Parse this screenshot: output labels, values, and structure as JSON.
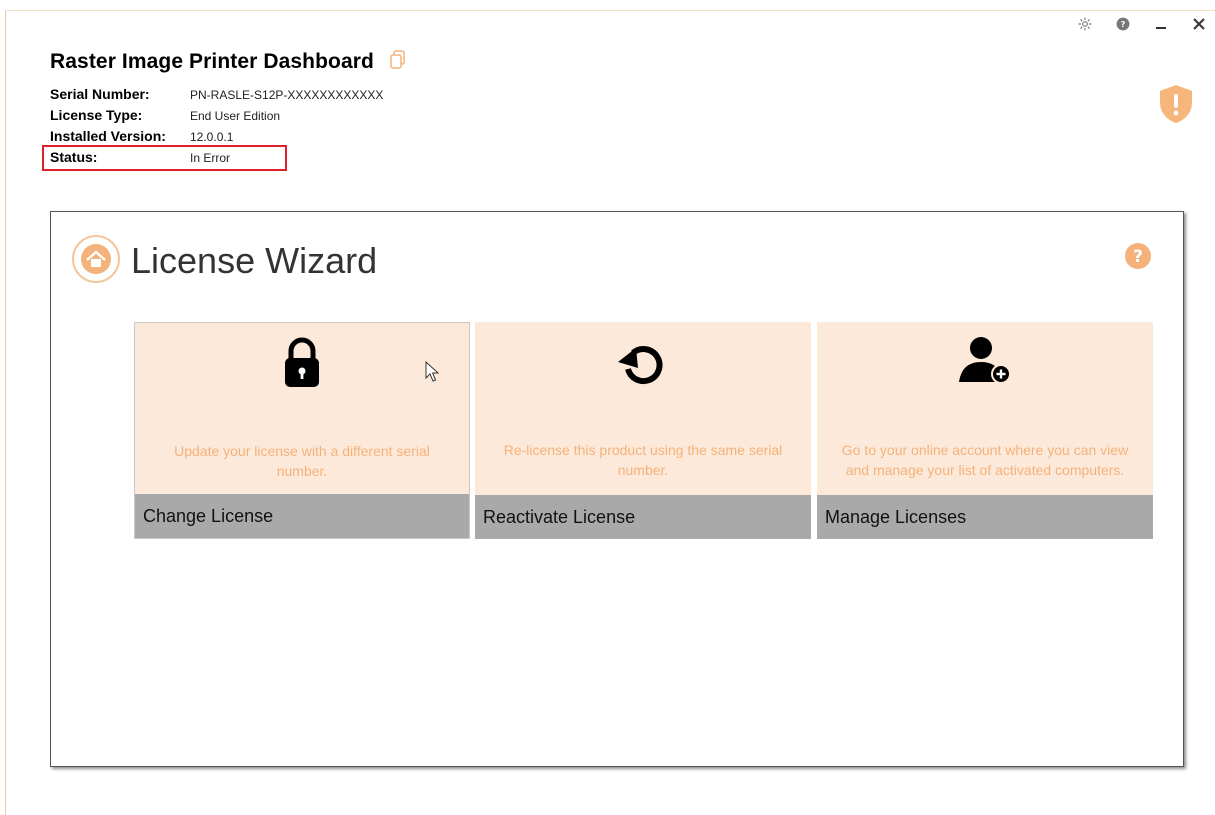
{
  "app": {
    "title": "Raster Image Printer Dashboard"
  },
  "license_info": {
    "serial_label": "Serial Number:",
    "serial_value": "PN-RASLE-S12P-XXXXXXXXXXXX",
    "type_label": "License Type:",
    "type_value": "End User Edition",
    "version_label": "Installed Version:",
    "version_value": "12.0.0.1",
    "status_label": "Status:",
    "status_value": "In Error"
  },
  "window_controls": {
    "icons": [
      "gear-icon",
      "help-icon",
      "minimize-icon",
      "close-icon"
    ]
  },
  "wizard": {
    "title": "License Wizard",
    "cards": [
      {
        "icon": "lock-icon",
        "description": "Update your license with a different serial number.",
        "label": "Change License"
      },
      {
        "icon": "refresh-icon",
        "description": "Re-license this product using the same serial number.",
        "label": "Reactivate License"
      },
      {
        "icon": "user-add-icon",
        "description": "Go to your online account where you can view and manage your list of activated computers.",
        "label": "Manage Licenses"
      }
    ]
  },
  "colors": {
    "accent": "#f4b27a",
    "card_bg": "#fde9da",
    "card_footer": "#a9a9a9",
    "shield": "#f6b57a",
    "status_highlight": "#e0202a"
  }
}
